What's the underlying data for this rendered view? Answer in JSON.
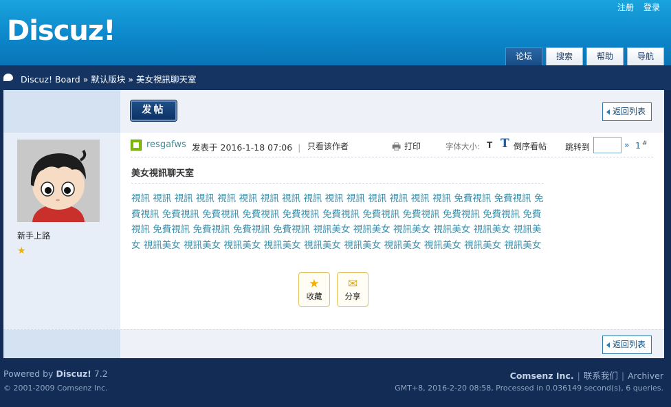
{
  "header": {
    "logo": "Discuz!",
    "top_links": [
      "注册",
      "登录"
    ],
    "nav_tabs": [
      {
        "label": "论坛",
        "active": true
      },
      {
        "label": "搜索",
        "active": false
      },
      {
        "label": "帮助",
        "active": false
      },
      {
        "label": "导航",
        "active": false
      }
    ]
  },
  "breadcrumb": {
    "items": [
      "Discuz! Board",
      "默认版块",
      "美女視訊聊天室"
    ],
    "separator": "»"
  },
  "toolbar": {
    "post_button": "发帖",
    "back_to_list": "返回列表"
  },
  "post": {
    "author": {
      "username": "resgafws",
      "rank": "新手上路",
      "stars": 1,
      "avatar_icon": "cartoon-avatar"
    },
    "posted_prefix": "发表于",
    "posted_time": "2016-1-18 07:06",
    "author_only": "只看该作者",
    "print": "打印",
    "font_size_label": "字体大小:",
    "font_size_t": "T",
    "reverse_icon": "T",
    "reverse": "倒序看帖",
    "goto_label": "跳转到",
    "goto_value": "",
    "goto_arrow": "»",
    "floor": "1",
    "floor_mark": "#",
    "title": "美女視訊聊天室",
    "body": "視訊 視訊 視訊 視訊 視訊 視訊 視訊 視訊 視訊 視訊 視訊 視訊 視訊 視訊 視訊 免費視訊 免費視訊 免費視訊 免費視訊 免費視訊 免費視訊 免費視訊 免費視訊 免費視訊 免費視訊 免費視訊 免費視訊 免費視訊 免費視訊 免費視訊 免費視訊 免費視訊 視訊美女 視訊美女 視訊美女 視訊美女 視訊美女 視訊美女 視訊美女 視訊美女 視訊美女 視訊美女 視訊美女 視訊美女 視訊美女 視訊美女 視訊美女 視訊美女",
    "actions": [
      {
        "label": "收藏",
        "icon": "star-icon"
      },
      {
        "label": "分享",
        "icon": "envelope-icon"
      }
    ]
  },
  "footer": {
    "powered_prefix": "Powered by",
    "powered_brand": "Discuz!",
    "powered_version": "7.2",
    "copyright": "© 2001-2009 Comsenz Inc.",
    "company": "Comsenz Inc.",
    "contact": "联系我们",
    "archiver": "Archiver",
    "stats": "GMT+8, 2016-2-20 08:58, Processed in 0.036149 second(s), 6 queries."
  },
  "colors": {
    "header_blue": "#0b86c9",
    "dark_navy": "#122c55",
    "link_teal": "#3a8eaa",
    "star_gold": "#f0b000"
  }
}
